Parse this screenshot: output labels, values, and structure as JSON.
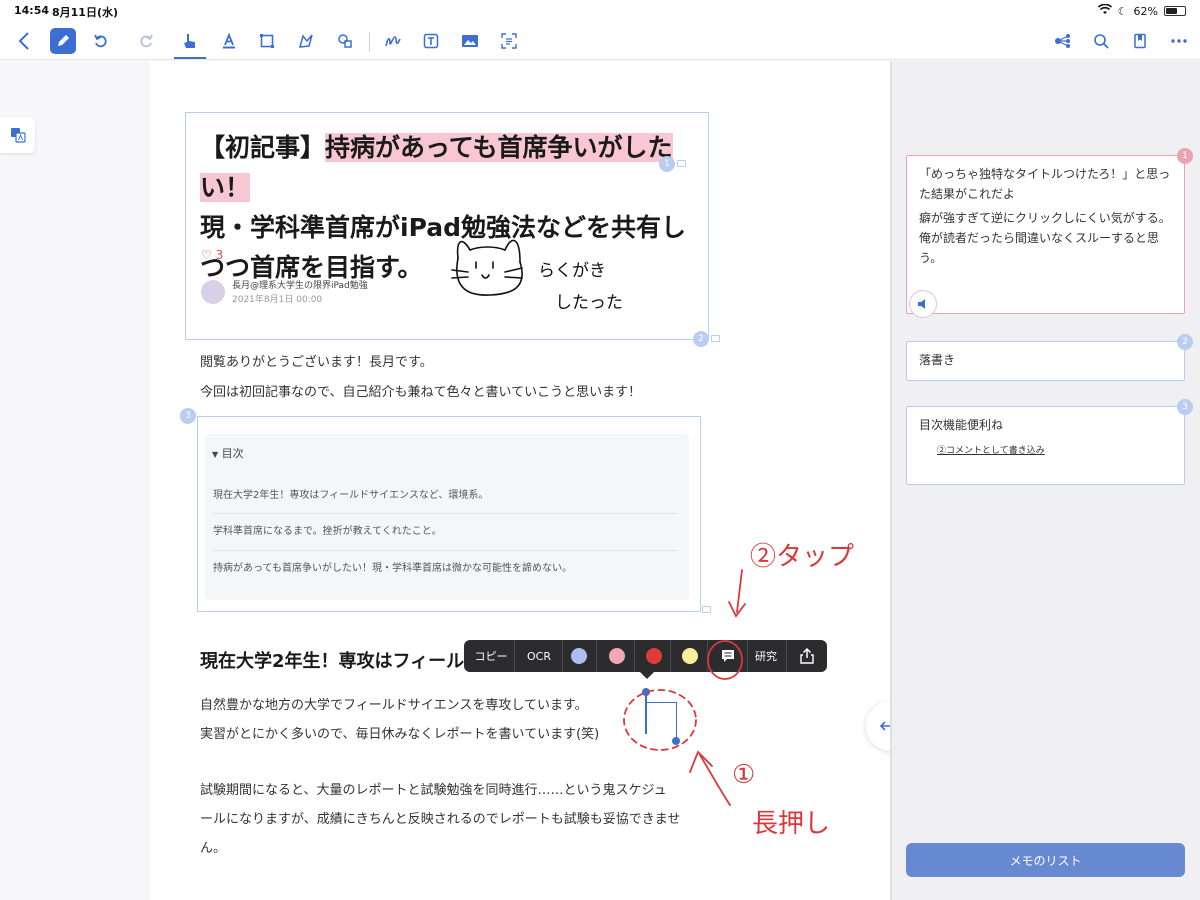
{
  "status": {
    "time": "14:54",
    "date": "8月11日(水)",
    "battery": "62%",
    "battery_level": 0.62
  },
  "toolbar": {
    "back_icon": "chevron-left-icon",
    "pen_icon": "pencil-icon",
    "undo_icon": "undo-icon",
    "redo_icon": "redo-icon",
    "hand_icon": "hand-pointer-icon",
    "text_highlight_icon": "text-underline-icon",
    "rect_select_icon": "rectangle-icon",
    "lasso_icon": "lasso-icon",
    "shape_icon": "shapes-icon",
    "scribble_icon": "scribble-icon",
    "text_box_icon": "text-box-icon",
    "image_icon": "image-icon",
    "scan_icon": "scan-text-icon",
    "share_nodes_icon": "mindmap-icon",
    "search_icon": "search-icon",
    "bookmark_icon": "bookmark-icon",
    "more_icon": "more-icon"
  },
  "document": {
    "title_prefix": "【初記事】",
    "title_highlight": "持病があっても首席争いがしたい！",
    "title_rest": "現・学科準首席がiPad勉強法などを共有しつつ首席を目指す。",
    "likes": "3",
    "author": "長月@理系大学生の限界iPad勉強",
    "post_date": "2021年8月1日 00:00",
    "doodle_text_1": "らくがき",
    "doodle_text_2": "したった",
    "intro_1": "閲覧ありがとうございます！長月です。",
    "intro_2": "今回は初回記事なので、自己紹介も兼ねて色々と書いていこうと思います！",
    "toc_heading": "目次",
    "toc_items": [
      "現在大学2年生！専攻はフィールドサイエンスなど、環境系。",
      "学科準首席になるまで。挫折が教えてくれたこと。",
      "持病があっても首席争いがしたい！現・学科準首席は微かな可能性を諦めない。"
    ],
    "section_heading": "現在大学2年生！専攻はフィールドサイエンスなど、環境系。",
    "body_1": "自然豊かな地方の大学でフィールドサイエンスを専攻しています。",
    "body_2": "実習がとにかく多いので、毎日休みなくレポートを書いています(笑)",
    "body_3": "試験期間になると、大量のレポートと試験勉強を同時進行……という鬼スケジュ",
    "body_4": "ールになりますが、成績にきちんと反映されるのでレポートも試験も妥協できませ",
    "body_5": "ん。",
    "badges": [
      "1",
      "2",
      "3"
    ]
  },
  "popup": {
    "copy": "コピー",
    "ocr": "OCR",
    "colors": [
      "#a9c0ec",
      "#f1a7b6",
      "#e03a3a",
      "#f5ee9b"
    ],
    "research": "研究",
    "comment_icon": "comment-icon",
    "share_icon": "share-icon"
  },
  "annotations": {
    "step2": "②タップ",
    "step1": "①",
    "long_press": "長押し"
  },
  "memos": [
    {
      "badge": "1",
      "lines": [
        "「めっちゃ独特なタイトルつけたろ！」と思った結果がこれだよ",
        "癖が強すぎて逆にクリックしにくい気がする。",
        "俺が読者だったら間違いなくスルーすると思う。"
      ]
    },
    {
      "badge": "2",
      "text": "落書き"
    },
    {
      "badge": "3",
      "text": "目次機能便利ね",
      "handwritten": "②コメントとして書き込み"
    }
  ],
  "memo_list_button": "メモのリスト",
  "colors": {
    "accent": "#3c6fd1",
    "highlight": "#f8c7d3",
    "annotation_red": "#d8393a"
  }
}
